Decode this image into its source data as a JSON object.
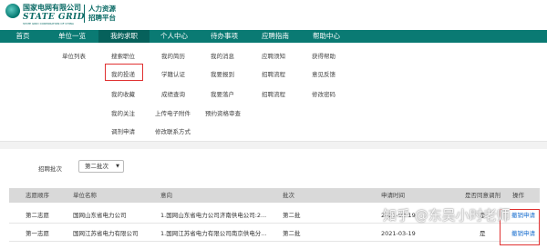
{
  "header": {
    "org_cn": "国家电网有限公司",
    "org_en": "STATE GRID",
    "org_sub": "STATE GRID CORPORATION OF CHINA",
    "platform_line1": "人力资源",
    "platform_line2": "招聘平台"
  },
  "nav": {
    "items": [
      "首页",
      "单位一览",
      "我的求职",
      "个人中心",
      "待办事项",
      "应聘指南",
      "帮助中心"
    ],
    "active": "我的求职"
  },
  "menu": {
    "col1": [
      "单位列表"
    ],
    "col2": [
      "搜索职位",
      "我的投递",
      "我的收藏",
      "我的关注",
      "调剂申请"
    ],
    "col3": [
      "我的简历",
      "学籍认证",
      "成绩查询",
      "上传电子附件",
      "修改联系方式"
    ],
    "col4": [
      "我的消息",
      "我要报到",
      "我要落户",
      "预约资格审查"
    ],
    "col5": [
      "应聘须知",
      "招聘流程",
      "招聘流程"
    ],
    "col6": [
      "获得帮助",
      "意见反馈",
      "修改密码"
    ]
  },
  "filter": {
    "label": "招聘批次",
    "value": "第二批次",
    "caret_icon": "caret-down-icon"
  },
  "table": {
    "headers": [
      "志愿顺序",
      "单位名称",
      "意向",
      "批次",
      "申请时间",
      "是否同意调剂",
      "操作"
    ],
    "rows": [
      [
        "第二志愿",
        "国网山东省电力公司",
        "1.国网山东省电力公司济南供电公司:2...",
        "第二批",
        "2021-03-19",
        "是",
        "撤销申请"
      ],
      [
        "第一志愿",
        "国网江苏省电力有限公司",
        "1.国网江苏省电力有限公司南京供电分...",
        "第二批",
        "2021-03-19",
        "是",
        "撤销申请"
      ]
    ]
  },
  "watermark": "知乎 @东吴小时老师",
  "colors": {
    "nav_bg": "#0a7a73",
    "nav_active": "#06615b",
    "highlight": "#e03131",
    "link": "#1a6fcf"
  }
}
